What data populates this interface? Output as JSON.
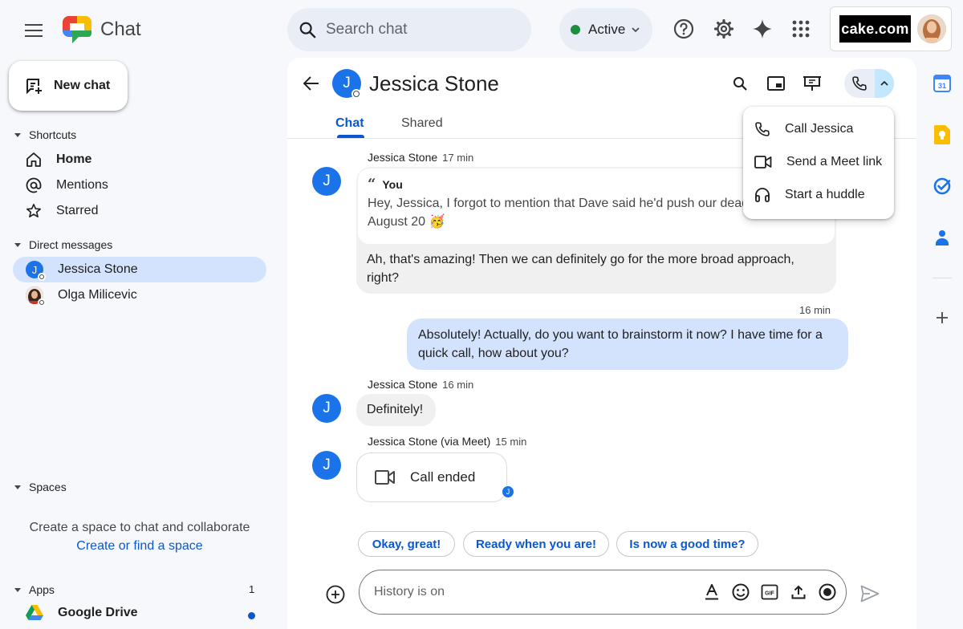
{
  "app": {
    "title": "Chat"
  },
  "search": {
    "placeholder": "Search chat"
  },
  "status": {
    "label": "Active",
    "color": "#1e8e3e"
  },
  "account": {
    "brand": "cake.com"
  },
  "sidebar": {
    "new_chat": "New chat",
    "shortcuts": {
      "title": "Shortcuts",
      "items": [
        {
          "label": "Home",
          "icon": "home-icon",
          "bold": true
        },
        {
          "label": "Mentions",
          "icon": "at-sign-icon"
        },
        {
          "label": "Starred",
          "icon": "star-icon"
        }
      ]
    },
    "direct_messages": {
      "title": "Direct messages",
      "items": [
        {
          "label": "Jessica Stone",
          "initial": "J",
          "active": true
        },
        {
          "label": "Olga Milicevic"
        }
      ]
    },
    "spaces": {
      "title": "Spaces",
      "empty_text": "Create a space to chat and collaborate",
      "link": "Create or find a space"
    },
    "apps": {
      "title": "Apps",
      "count": "1",
      "items": [
        {
          "label": "Google Drive",
          "icon": "google-drive-icon"
        }
      ]
    }
  },
  "conversation": {
    "contact": {
      "name": "Jessica Stone",
      "initial": "J"
    },
    "tabs": [
      {
        "label": "Chat",
        "active": true
      },
      {
        "label": "Shared"
      }
    ],
    "call_menu": [
      {
        "label": "Call Jessica",
        "icon": "phone-icon"
      },
      {
        "label": "Send a Meet link",
        "icon": "video-camera-icon"
      },
      {
        "label": "Start a huddle",
        "icon": "headphones-icon"
      }
    ],
    "messages": [
      {
        "sender": "Jessica Stone",
        "time": "17 min",
        "quote_author": "You",
        "quote_text": "Hey, Jessica, I forgot to mention that Dave said he'd push our deadline to",
        "quote_text_2": "August 20 🥳",
        "text": "Ah, that's amazing! Then we can definitely go for the more broad approach,",
        "text_2": "right?"
      },
      {
        "time": "16 min",
        "text": "Absolutely!  Actually, do you want to brainstorm it now? I have time for a",
        "text_2": "quick call, how about you?"
      },
      {
        "sender": "Jessica Stone",
        "time": "16 min",
        "text": "Definitely!"
      },
      {
        "sender": "Jessica Stone (via Meet)",
        "time": "15 min",
        "card": "Call ended",
        "badge": "J"
      }
    ],
    "smart_replies": [
      "Okay, great!",
      "Ready when you are!",
      "Is now a good time?"
    ],
    "composer": {
      "placeholder": "History is on"
    }
  },
  "colors": {
    "accent": "#0b57d0",
    "active_nav": "#d3e3fd",
    "outgoing_bubble": "#d3e3fd",
    "incoming_bubble": "#f0f0f0"
  }
}
